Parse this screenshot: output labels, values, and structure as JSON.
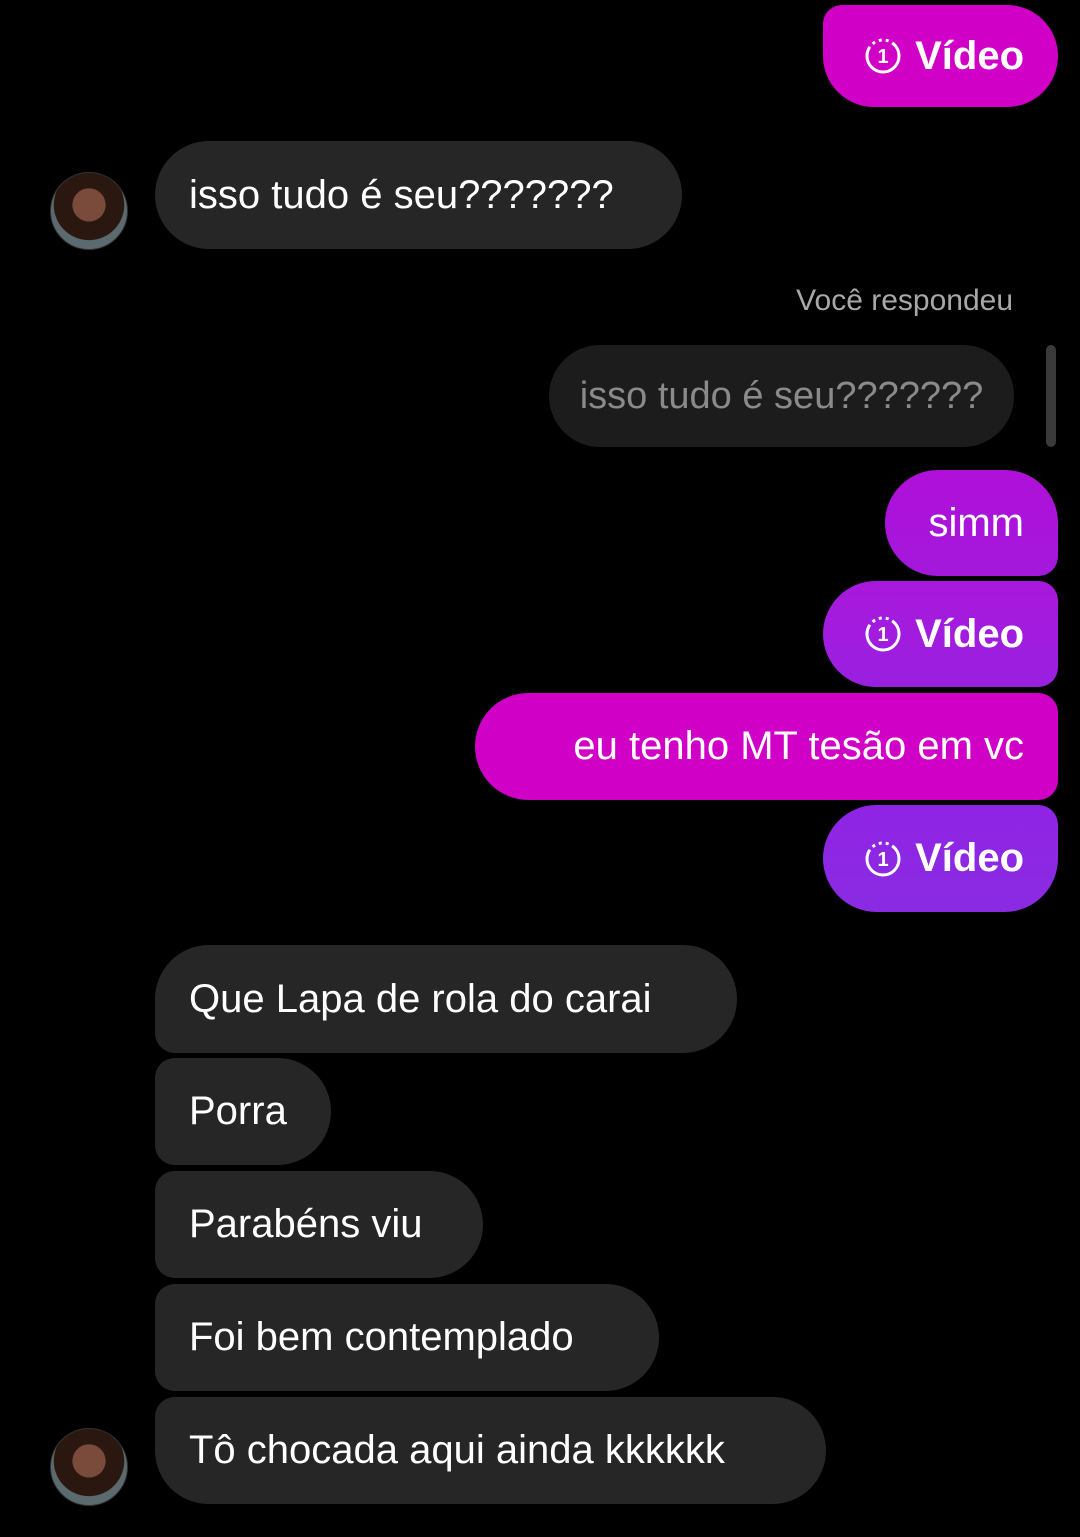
{
  "colors": {
    "sent_magenta": "#d000c6",
    "sent_purple": "#8a2be2",
    "received_bubble": "#262626",
    "background": "#000000"
  },
  "messages": [
    {
      "id": "m1",
      "direction": "sent",
      "type": "video",
      "text": "Vídeo",
      "icon": "view-once-icon"
    },
    {
      "id": "m2",
      "direction": "received",
      "type": "text",
      "text": "isso tudo é seu???????"
    },
    {
      "id": "m3",
      "direction": "sent",
      "type": "reply",
      "reply_label": "Você respondeu",
      "quoted_text": "isso tudo é seu???????"
    },
    {
      "id": "m4",
      "direction": "sent",
      "type": "text",
      "text": "simm"
    },
    {
      "id": "m5",
      "direction": "sent",
      "type": "video",
      "text": "Vídeo",
      "icon": "view-once-icon"
    },
    {
      "id": "m6",
      "direction": "sent",
      "type": "text",
      "text": "eu tenho MT tesão em vc"
    },
    {
      "id": "m7",
      "direction": "sent",
      "type": "video",
      "text": "Vídeo",
      "icon": "view-once-icon"
    },
    {
      "id": "m8",
      "direction": "received",
      "type": "text",
      "text": "Que Lapa de rola do carai"
    },
    {
      "id": "m9",
      "direction": "received",
      "type": "text",
      "text": "Porra"
    },
    {
      "id": "m10",
      "direction": "received",
      "type": "text",
      "text": "Parabéns viu"
    },
    {
      "id": "m11",
      "direction": "received",
      "type": "text",
      "text": "Foi bem contemplado"
    },
    {
      "id": "m12",
      "direction": "received",
      "type": "text",
      "text": "Tô chocada aqui ainda kkkkkk"
    }
  ]
}
